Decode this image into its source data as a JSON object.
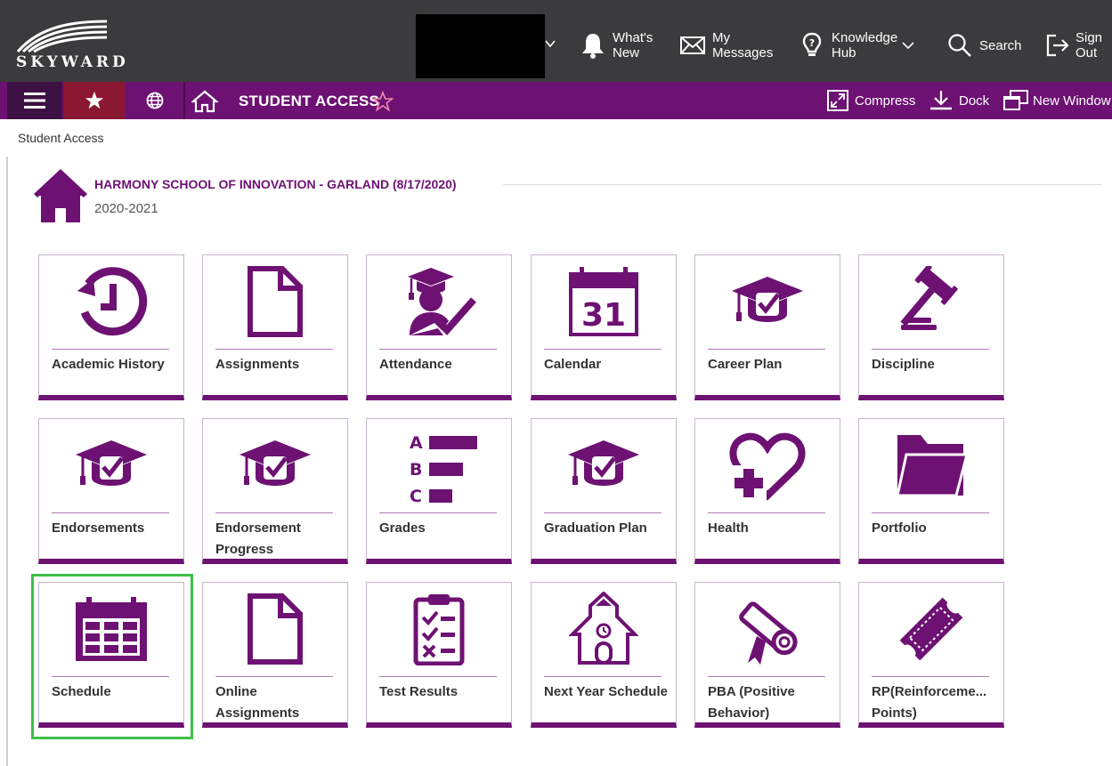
{
  "header": {
    "logo_text": "SKYWARD",
    "whats_new": [
      "What's",
      "New"
    ],
    "my_messages": [
      "My",
      "Messages"
    ],
    "knowledge_hub": [
      "Knowledge",
      "Hub"
    ],
    "search": "Search",
    "sign_out": [
      "Sign",
      "Out"
    ]
  },
  "nav": {
    "title": "STUDENT ACCESS",
    "compress": "Compress",
    "dock": "Dock",
    "new_window": "New Window"
  },
  "breadcrumb": "Student Access",
  "school": {
    "name": "HARMONY SCHOOL OF INNOVATION - GARLAND (8/17/2020)",
    "year": "2020-2021"
  },
  "tiles": [
    {
      "label": "Academic History",
      "icon": "history-icon"
    },
    {
      "label": "Assignments",
      "icon": "document-icon"
    },
    {
      "label": "Attendance",
      "icon": "student-check-icon"
    },
    {
      "label": "Calendar",
      "icon": "calendar-31-icon",
      "day": "31"
    },
    {
      "label": "Career Plan",
      "icon": "grad-cap-check-icon"
    },
    {
      "label": "Discipline",
      "icon": "gavel-icon"
    },
    {
      "label": "Endorsements",
      "icon": "grad-cap-check-icon"
    },
    {
      "label": "Endorsement Progress",
      "icon": "grad-cap-check-icon"
    },
    {
      "label": "Grades",
      "icon": "grades-bars-icon",
      "letters": [
        "A",
        "B",
        "C"
      ]
    },
    {
      "label": "Graduation Plan",
      "icon": "grad-cap-check-icon"
    },
    {
      "label": "Health",
      "icon": "heart-plus-icon"
    },
    {
      "label": "Portfolio",
      "icon": "folder-icon"
    },
    {
      "label": "Schedule",
      "icon": "schedule-grid-icon"
    },
    {
      "label": "Online Assignments",
      "icon": "document-icon"
    },
    {
      "label": "Test Results",
      "icon": "checklist-icon"
    },
    {
      "label": "Next Year Schedule",
      "icon": "schoolhouse-icon"
    },
    {
      "label": "PBA (Positive Behavior)",
      "icon": "diploma-scroll-icon"
    },
    {
      "label": "RP(Reinforceme... Points)",
      "icon": "ticket-icon"
    }
  ],
  "selected_tile": "Schedule",
  "colors": {
    "header_bg": "#3b3b3d",
    "nav_purple": "#6d1173",
    "tile_accent": "#6d1173",
    "selection_green": "#3dbf4a"
  }
}
